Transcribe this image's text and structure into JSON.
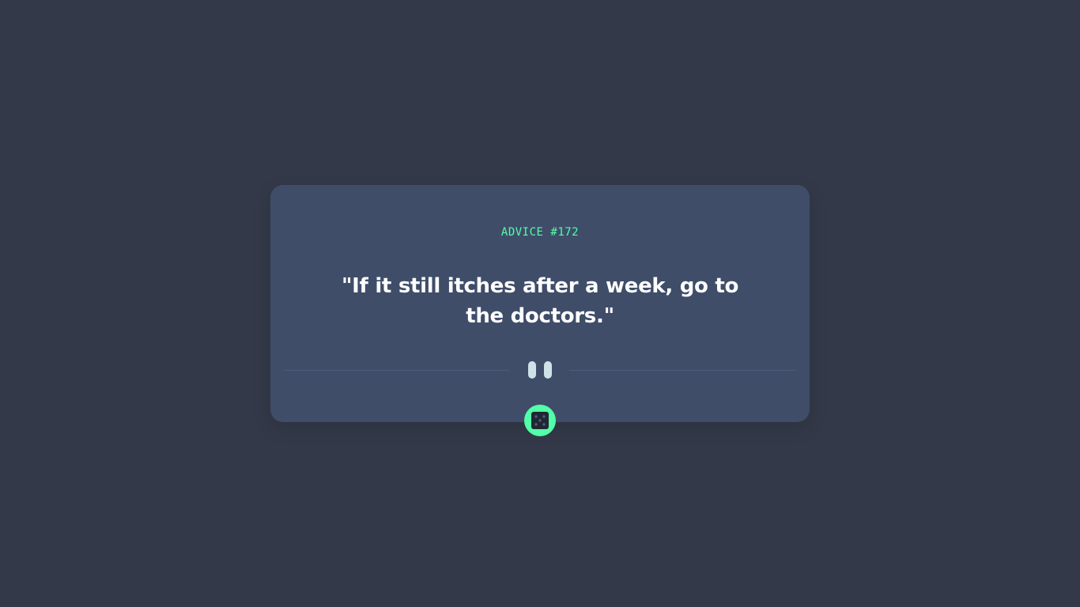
{
  "advice": {
    "label": "ADVICE #172",
    "quote": "\"If it still itches after a week, go to the doctors.\""
  },
  "divider": {
    "icon": "pause-icon"
  },
  "dice_button": {
    "icon": "dice-icon"
  },
  "colors": {
    "background": "#333948",
    "card": "#3f4d69",
    "accent": "#52ffa8",
    "text": "#ffffff",
    "divider_icon": "#cee3e9"
  }
}
